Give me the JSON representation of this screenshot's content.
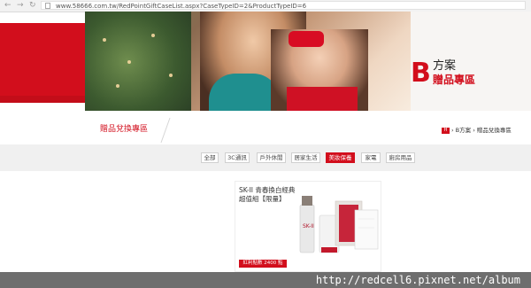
{
  "browser": {
    "back_icon": "back-arrow-icon",
    "forward_icon": "forward-arrow-icon",
    "reload_icon": "reload-icon",
    "url": "www.58666.com.tw/RedPointGiftCaseList.aspx?CaseTypeID=2&ProductTypeID=6"
  },
  "banner": {
    "letter": "B",
    "plan": "方案",
    "title": "贈品專區"
  },
  "breadcrumb": {
    "page_title": "贈品兌換專區",
    "home_icon": "home-icon",
    "home_label": "H",
    "path": "› B方案 › 贈品兌換專區"
  },
  "tabs": [
    {
      "label": "全部",
      "active": false
    },
    {
      "label": "3C通訊",
      "active": false
    },
    {
      "label": "戶外休閒",
      "active": false
    },
    {
      "label": "居家生活",
      "active": false
    },
    {
      "label": "美妝保養",
      "active": true
    },
    {
      "label": "家電",
      "active": false
    },
    {
      "label": "廚房用品",
      "active": false
    }
  ],
  "product": {
    "name": "SK-II 青春換白經典超值組【限量】",
    "points": "紅利點數 2400 點",
    "brand_mark": "SK-II"
  },
  "watermark": "http://redcell6.pixnet.net/album",
  "colors": {
    "accent": "#d20e1c",
    "tab_bar": "#f0f0f0",
    "watermark_bar": "#6e6e6e"
  }
}
